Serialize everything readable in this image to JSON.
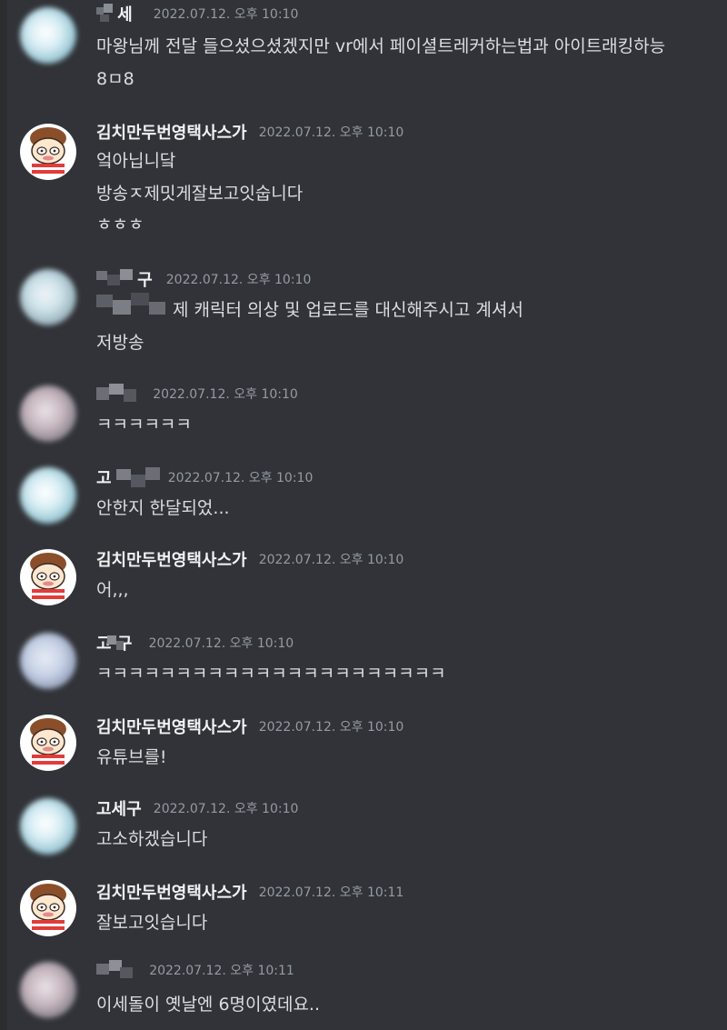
{
  "messages": [
    {
      "username": "세",
      "timestamp": "2022.07.12. 오후 10:10",
      "lines": [
        "마왕님께 전달 들으셨으셨겠지만 vr에서 페이셜트레커하는법과 아이트래킹하능",
        "8ㅁ8"
      ]
    },
    {
      "username": "김치만두번영택사스가",
      "timestamp": "2022.07.12. 오후 10:10",
      "lines": [
        "엌아닙니닼",
        "방송ㅈ제밋게잘보고잇숩니다",
        "ㅎㅎㅎ"
      ]
    },
    {
      "username": "구",
      "timestamp": "2022.07.12. 오후 10:10",
      "lines": [
        "제 캐릭터 의상 및 업로드를 대신해주시고 계셔서",
        "저방송"
      ]
    },
    {
      "username": "",
      "timestamp": "2022.07.12. 오후 10:10",
      "lines": [
        "ㅋㅋㅋㅋㅋㅋ"
      ]
    },
    {
      "username": "고",
      "timestamp": "2022.07.12. 오후 10:10",
      "lines": [
        "안한지 한달되었..."
      ]
    },
    {
      "username": "김치만두번영택사스가",
      "timestamp": "2022.07.12. 오후 10:10",
      "lines": [
        "어,,,"
      ]
    },
    {
      "username": "고 구",
      "timestamp": "2022.07.12. 오후 10:10",
      "lines": [
        "ㅋㅋㅋㅋㅋㅋㅋㅋㅋㅋㅋㅋㅋㅋㅋㅋㅋㅋㅋㅋㅋㅋ"
      ]
    },
    {
      "username": "김치만두번영택사스가",
      "timestamp": "2022.07.12. 오후 10:10",
      "lines": [
        "유튜브를!"
      ]
    },
    {
      "username": "고세구",
      "timestamp": "2022.07.12. 오후 10:10",
      "lines": [
        "고소하겠습니다"
      ]
    },
    {
      "username": "김치만두번영택사스가",
      "timestamp": "2022.07.12. 오후 10:11",
      "lines": [
        "잘보고잇습니다"
      ]
    },
    {
      "username": "",
      "timestamp": "2022.07.12. 오후 10:11",
      "lines": [
        "이세돌이 옛날엔 6명이였데요.."
      ]
    }
  ],
  "colors": {
    "background": "#313338",
    "username": "#f2f3f5",
    "timestamp": "#949ba4",
    "text": "#dbdee1"
  },
  "icons": [
    "blurred-avatar-icon",
    "kimchi-avatar-icon"
  ]
}
